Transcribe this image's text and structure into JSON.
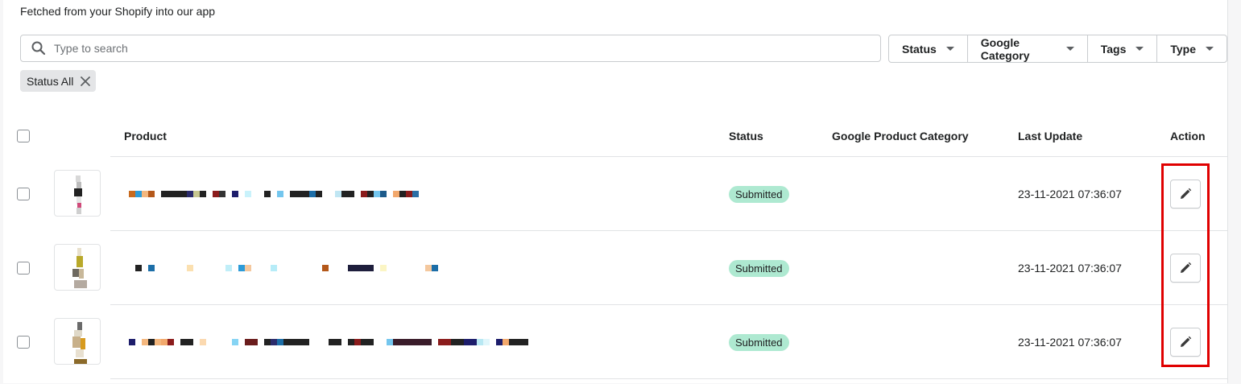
{
  "subtitle": "Fetched from your Shopify into our app",
  "search": {
    "placeholder": "Type to search"
  },
  "filters": [
    {
      "label": "Status"
    },
    {
      "label": "Google Category"
    },
    {
      "label": "Tags"
    },
    {
      "label": "Type"
    }
  ],
  "applied_filter": {
    "label": "Status All"
  },
  "table": {
    "headers": {
      "product": "Product",
      "status": "Status",
      "google_category": "Google Product Category",
      "last_update": "Last Update",
      "action": "Action"
    },
    "rows": [
      {
        "product": "",
        "status": "Submitted",
        "google_category": "",
        "last_update": "23-11-2021 07:36:07"
      },
      {
        "product": "",
        "status": "Submitted",
        "google_category": "",
        "last_update": "23-11-2021 07:36:07"
      },
      {
        "product": "",
        "status": "Submitted",
        "google_category": "",
        "last_update": "23-11-2021 07:36:07"
      }
    ]
  },
  "colors": {
    "status_badge": "#aee9d1",
    "highlight_box": "#e00000"
  },
  "icons": {
    "search": "search-icon",
    "dropdown": "caret-down-icon",
    "remove_filter": "close-icon",
    "edit": "pencil-icon"
  }
}
